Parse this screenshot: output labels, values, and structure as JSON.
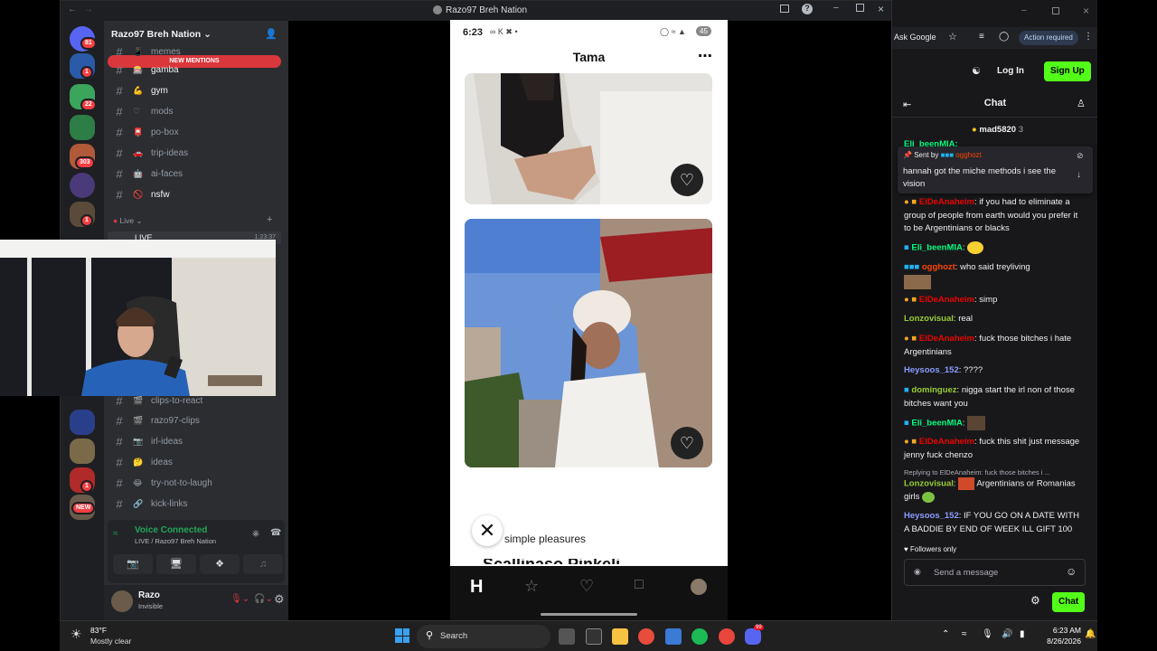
{
  "window": {
    "title": "Razo97 Breh Nation"
  },
  "server": {
    "name": "Razo97 Breh Nation",
    "new_mentions": "NEW MENTIONS"
  },
  "guild_badges": [
    "81",
    "1",
    "22",
    "303",
    "1",
    "1",
    "NEW"
  ],
  "channels_top": [
    {
      "name": "memes",
      "emoji": "📱"
    },
    {
      "name": "gamba",
      "emoji": "🎰"
    },
    {
      "name": "gym",
      "emoji": "💪"
    },
    {
      "name": "mods",
      "emoji": "♡"
    },
    {
      "name": "po-box",
      "emoji": "📮"
    },
    {
      "name": "trip-ideas",
      "emoji": "🚗"
    },
    {
      "name": "ai-faces",
      "emoji": "🤖"
    },
    {
      "name": "nsfw",
      "emoji": "🚫"
    }
  ],
  "live_section": {
    "label": "Live",
    "channel": "LIVE",
    "time": "1:23:37"
  },
  "channels_bottom": [
    {
      "name": "clips-to-react",
      "emoji": "🎬"
    },
    {
      "name": "razo97-clips",
      "emoji": "🎬"
    },
    {
      "name": "irl-ideas",
      "emoji": "📷"
    },
    {
      "name": "ideas",
      "emoji": "🤔"
    },
    {
      "name": "try-not-to-laugh",
      "emoji": "😂"
    },
    {
      "name": "kick-links",
      "emoji": "🔗"
    }
  ],
  "voice": {
    "status": "Voice Connected",
    "channel": "LIVE / Razo97 Breh Nation"
  },
  "user": {
    "name": "Razo",
    "status": "Invisible"
  },
  "phone": {
    "time": "6:23",
    "battery": "45",
    "profile_name": "Tama",
    "prompt": "simple pleasures",
    "prompt_next": "Scallinaso Pinkeli"
  },
  "browser": {
    "ask_google": "Ask Google",
    "action_required": "Action required",
    "login": "Log In",
    "signup": "Sign Up",
    "chat_title": "Chat",
    "followers_only": "Followers only",
    "send_placeholder": "Send a message",
    "chat_button": "Chat"
  },
  "pinned": {
    "top_user": "mad5820",
    "top_count": "3",
    "partial_user": "Eli_beenMIA:",
    "sent_by": "Sent by",
    "sent_user": "ogghozt",
    "text": "hannah got the miche methods i see the vision"
  },
  "chat": [
    {
      "user": "ElDeAnaheim",
      "color": "#eb0400",
      "text": "if you had to eliminate a group of people from earth would you prefer it to be Argentinians or blacks"
    },
    {
      "user": "Eli_beenMIA",
      "color": "#00ff7f",
      "text": ""
    },
    {
      "user": "ogghozt",
      "color": "#ff4500",
      "text": "who said treyliving"
    },
    {
      "user": "ElDeAnaheim",
      "color": "#eb0400",
      "text": "simp"
    },
    {
      "user": "Lonzovisual",
      "color": "#9acd32",
      "text": "real"
    },
    {
      "user": "ElDeAnaheim",
      "color": "#eb0400",
      "text": "fuck those bitches i hate Argentinians"
    },
    {
      "user": "Heysoos_152",
      "color": "#8a9dff",
      "text": "????"
    },
    {
      "user": "dominguez",
      "color": "#9acd32",
      "text": "nigga start the irl non of those bitches want you"
    },
    {
      "user": "Eli_beenMIA",
      "color": "#00ff7f",
      "text": ""
    },
    {
      "user": "ElDeAnaheim",
      "color": "#eb0400",
      "text": "fuck this shit just message jenny fuck chenzo"
    },
    {
      "user": "Lonzovisual",
      "color": "#9acd32",
      "text": "Argentinians or Romanias girls",
      "reply": "Replying to ElDeAnaheim: fuck those bitches i ..."
    },
    {
      "user": "Heysoos_152",
      "color": "#8a9dff",
      "text": "IF YOU GO ON A DATE WITH A BADDIE BY END OF WEEK ILL GIFT 100"
    }
  ],
  "taskbar": {
    "temp": "83°F",
    "weather": "Mostly clear",
    "search": "Search",
    "time": "6:23 AM",
    "date": "8/26/2026",
    "discord_badge": "99"
  }
}
